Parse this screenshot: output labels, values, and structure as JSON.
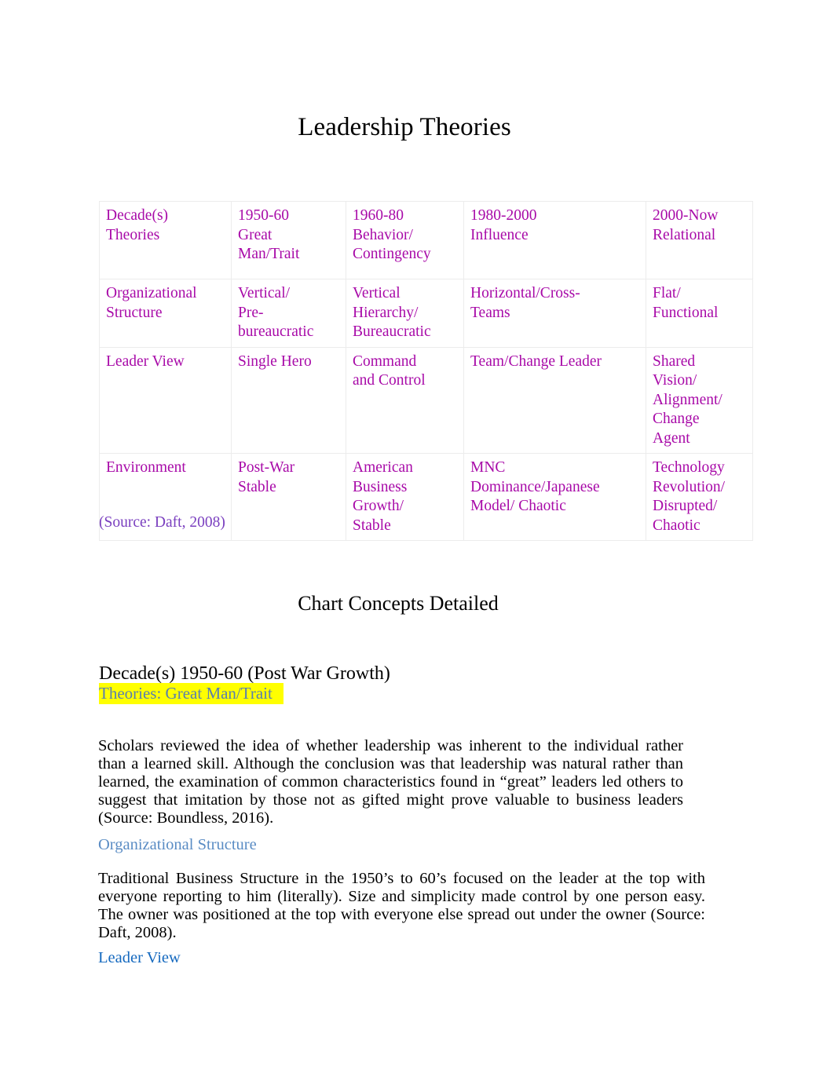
{
  "document": {
    "title": "Leadership Theories",
    "section_heading": "Chart Concepts Detailed",
    "source_caption": "(Source: Daft, 2008)"
  },
  "colors": {
    "table_text": "#a80aa8",
    "source_caption": "#7a3fbf",
    "highlight_background": "#ffff00",
    "highlight_text": "#5a7fae",
    "blue_heading": "#5a8cc4",
    "leader_view_heading": "#1569bf",
    "table_border": "#ececec",
    "body_text": "#000000"
  },
  "chart_data": {
    "type": "table",
    "title": "Leadership Theories",
    "caption": "(Source: Daft, 2008)",
    "row_headers": [
      "Decade(s)\nTheories",
      "Organizational\nStructure",
      "Leader View",
      "Environment"
    ],
    "categories": [
      "1950-60",
      "1960-80",
      "1980-2000",
      "2000-Now"
    ],
    "rows": [
      {
        "header_line1": "Decade(s)",
        "header_line2": "Theories",
        "cells": [
          "1950-60\nGreat\nMan/Trait",
          "1960-80\nBehavior/\nContingency",
          "1980-2000\nInfluence",
          "2000-Now\nRelational"
        ]
      },
      {
        "header_line1": "Organizational",
        "header_line2": "Structure",
        "cells": [
          "Vertical/\nPre-\nbureaucratic",
          "Vertical\nHierarchy/\nBureaucratic",
          "Horizontal/Cross-\nTeams",
          "Flat/\nFunctional"
        ]
      },
      {
        "header_line1": "Leader View",
        "header_line2": "",
        "cells": [
          "Single Hero",
          "Command\nand Control",
          "Team/Change Leader",
          "Shared\nVision/\nAlignment/\nChange\nAgent"
        ]
      },
      {
        "header_line1": "Environment",
        "header_line2": "",
        "cells": [
          "Post-War\nStable",
          "American\nBusiness\nGrowth/\nStable",
          "MNC\nDominance/Japanese\nModel/ Chaotic",
          "Technology\nRevolution/\nDisrupted/\nChaotic"
        ]
      }
    ]
  },
  "sections": [
    {
      "decade_heading": "Decade(s) 1950-60 (Post War Growth)",
      "highlighted_heading": "Theories: Great Man/Trait",
      "paragraph": "Scholars reviewed the idea of whether leadership was inherent to the individual rather than a learned skill. Although the conclusion was that leadership was natural rather than learned, the examination of common characteristics found in “great” leaders led others to suggest that imitation by those not as gifted might prove valuable to business leaders (Source:   Boundless, 2016)."
    },
    {
      "blue_heading": "Organizational Structure",
      "paragraph": "Traditional Business Structure in the 1950’s to 60’s focused on the leader at the top with everyone reporting to him (literally).     Size and simplicity made control by one person easy.    The owner was positioned at the top with everyone else spread out under the owner (Source:    Daft, 2008)."
    },
    {
      "blue_heading": "Leader View"
    }
  ]
}
